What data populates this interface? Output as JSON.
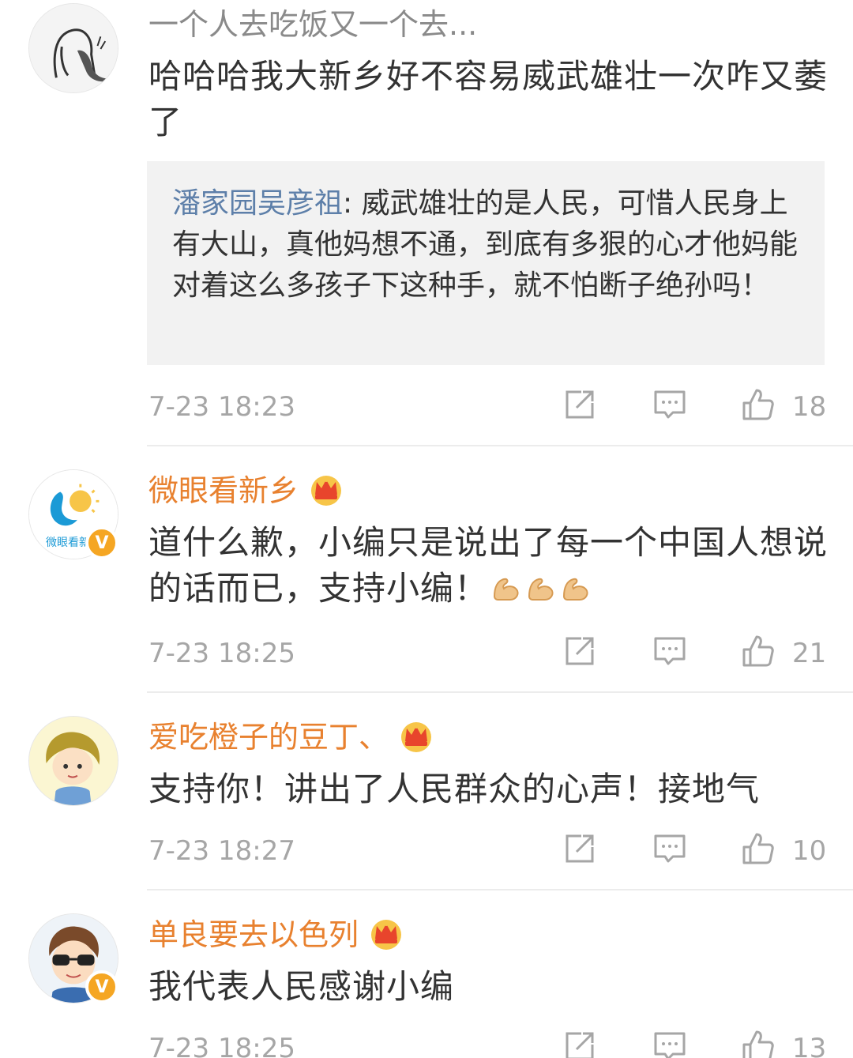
{
  "comments": [
    {
      "username": "一个人去吃饭又一个去...",
      "text": "哈哈哈我大新乡好不容易威武雄壮一次咋又萎了",
      "quote": {
        "name": "潘家园吴彦祖",
        "text": ": 威武雄壮的是人民，可惜人民身上有大山，真他妈想不通，到底有多狠的心才他妈能对着这么多孩子下这种手，就不怕断子绝孙吗！"
      },
      "time": "7-23 18:23",
      "likes": "18"
    },
    {
      "username": "微眼看新乡",
      "avatar_text": "微眼看新",
      "text": "道什么歉，小编只是说出了每一个中国人想说的话而已，支持小编！",
      "time": "7-23 18:25",
      "likes": "21"
    },
    {
      "username": "爱吃橙子的豆丁、",
      "text": "支持你！讲出了人民群众的心声！接地气",
      "time": "7-23 18:27",
      "likes": "10"
    },
    {
      "username": "单良要去以色列",
      "text": "我代表人民感谢小编",
      "time": "7-23 18:25",
      "likes": "13"
    }
  ],
  "colors": {
    "username_orange": "#e8812f",
    "quote_name": "#5d7fa9",
    "meta_gray": "#a6a6a6",
    "verified_badge": "#f5a623"
  },
  "icons": [
    "share-icon",
    "comment-icon",
    "like-icon",
    "crown-icon",
    "verified-icon",
    "flex-arm-emoji"
  ]
}
